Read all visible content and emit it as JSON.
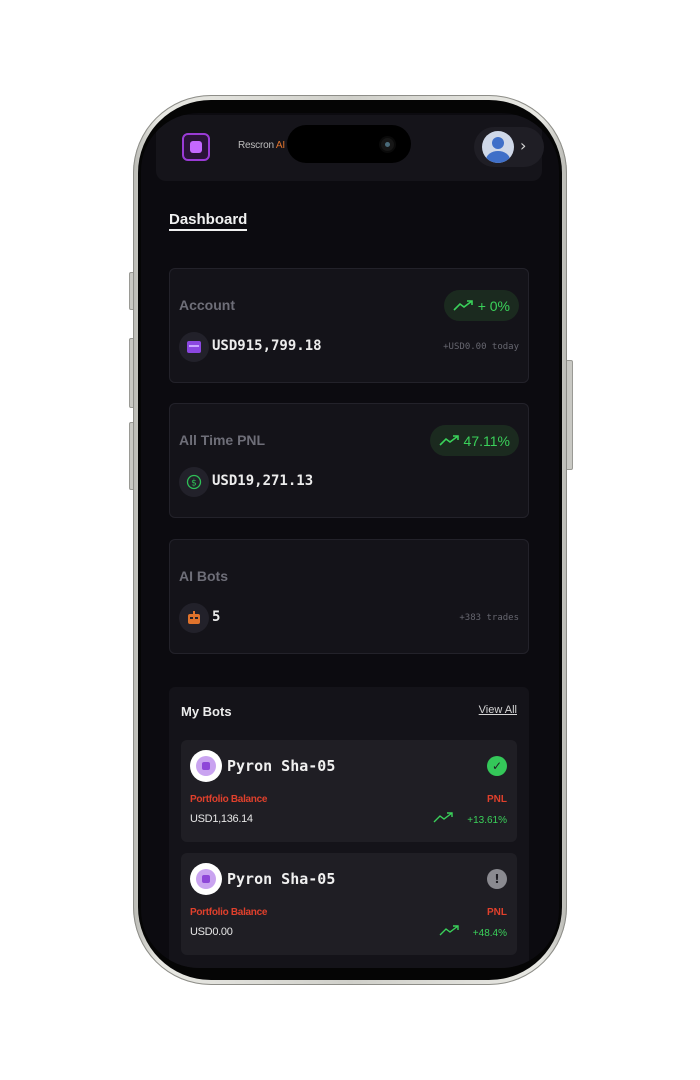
{
  "header": {
    "brand_name": "Rescron",
    "brand_suffix": "AI",
    "profile_chevron": "›"
  },
  "page": {
    "title": "Dashboard"
  },
  "cards": {
    "account": {
      "label": "Account",
      "badge": "+ 0%",
      "value": "USD915,799.18",
      "sub": "+USD0.00 today",
      "icon": "wallet-icon"
    },
    "pnl": {
      "label": "All Time PNL",
      "badge": "47.11%",
      "value": "USD19,271.13",
      "icon": "dollar-icon"
    },
    "bots": {
      "label": "AI Bots",
      "value": "5",
      "sub": "+383 trades",
      "icon": "robot-icon"
    }
  },
  "my_bots": {
    "title": "My Bots",
    "view_all": "View All",
    "items": [
      {
        "name": "Pyron Sha-05",
        "status": "active",
        "status_color": "#34c759",
        "pb_label": "Portfolio Balance",
        "balance": "USD1,136.14",
        "pnl_label": "PNL",
        "pnl": "+13.61%"
      },
      {
        "name": "Pyron Sha-05",
        "status": "inactive",
        "status_color": "#8a8a90",
        "pb_label": "Portfolio Balance",
        "balance": "USD0.00",
        "pnl_label": "PNL",
        "pnl": "+48.4%"
      }
    ]
  },
  "colors": {
    "background": "#0c0b10",
    "card": "#141319",
    "positive": "#3ad15a",
    "label_red": "#e0402c",
    "brand_purple": "#9a3bd6",
    "brand_orange": "#e0732c"
  }
}
